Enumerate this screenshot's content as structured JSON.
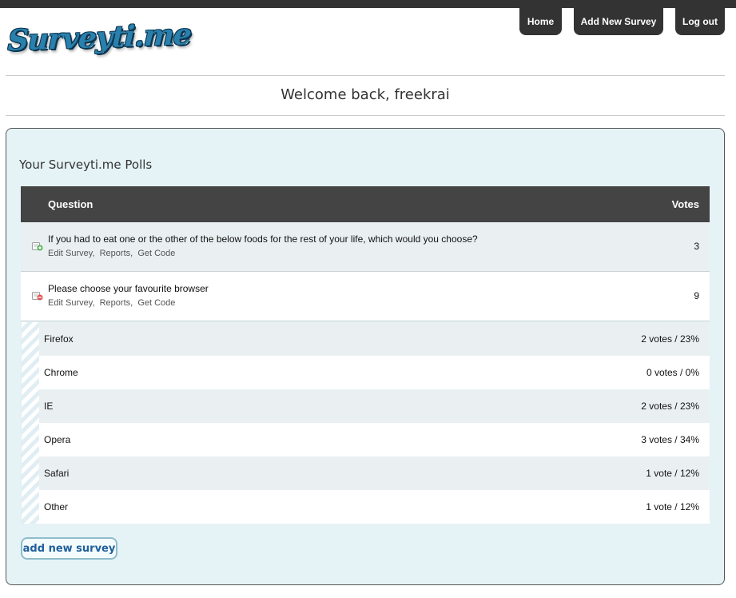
{
  "brand": {
    "logo_text": "Surveyti.me"
  },
  "nav": {
    "home": "Home",
    "add_survey": "Add New Survey",
    "logout": "Log out"
  },
  "welcome": "Welcome back, freekrai",
  "panel_title": "Your Surveyti.me Polls",
  "table": {
    "col_question": "Question",
    "col_votes": "Votes"
  },
  "polls": [
    {
      "question": "If you had to eat one or the other of the below foods for the rest of your life, which would you choose?",
      "votes": "3",
      "expand_icon": "expand-plus-icon",
      "links": [
        "Edit Survey",
        "Reports",
        "Get Code"
      ]
    },
    {
      "question": "Please choose your favourite browser",
      "votes": "9",
      "expand_icon": "collapse-minus-icon",
      "links": [
        "Edit Survey",
        "Reports",
        "Get Code"
      ]
    }
  ],
  "options": [
    {
      "name": "Firefox",
      "votes": "2 votes / 23%"
    },
    {
      "name": "Chrome",
      "votes": "0 votes / 0%"
    },
    {
      "name": "IE",
      "votes": "2 votes / 23%"
    },
    {
      "name": "Opera",
      "votes": "3 votes / 34%"
    },
    {
      "name": "Safari",
      "votes": "1 vote / 12%"
    },
    {
      "name": "Other",
      "votes": "1 vote / 12%"
    }
  ],
  "add_button": "add new survey",
  "colors": {
    "header_dark": "#333333",
    "panel_bg": "#e5f3f6",
    "link_blue": "#1f5f9a",
    "logo_blue": "#2a80ad"
  }
}
